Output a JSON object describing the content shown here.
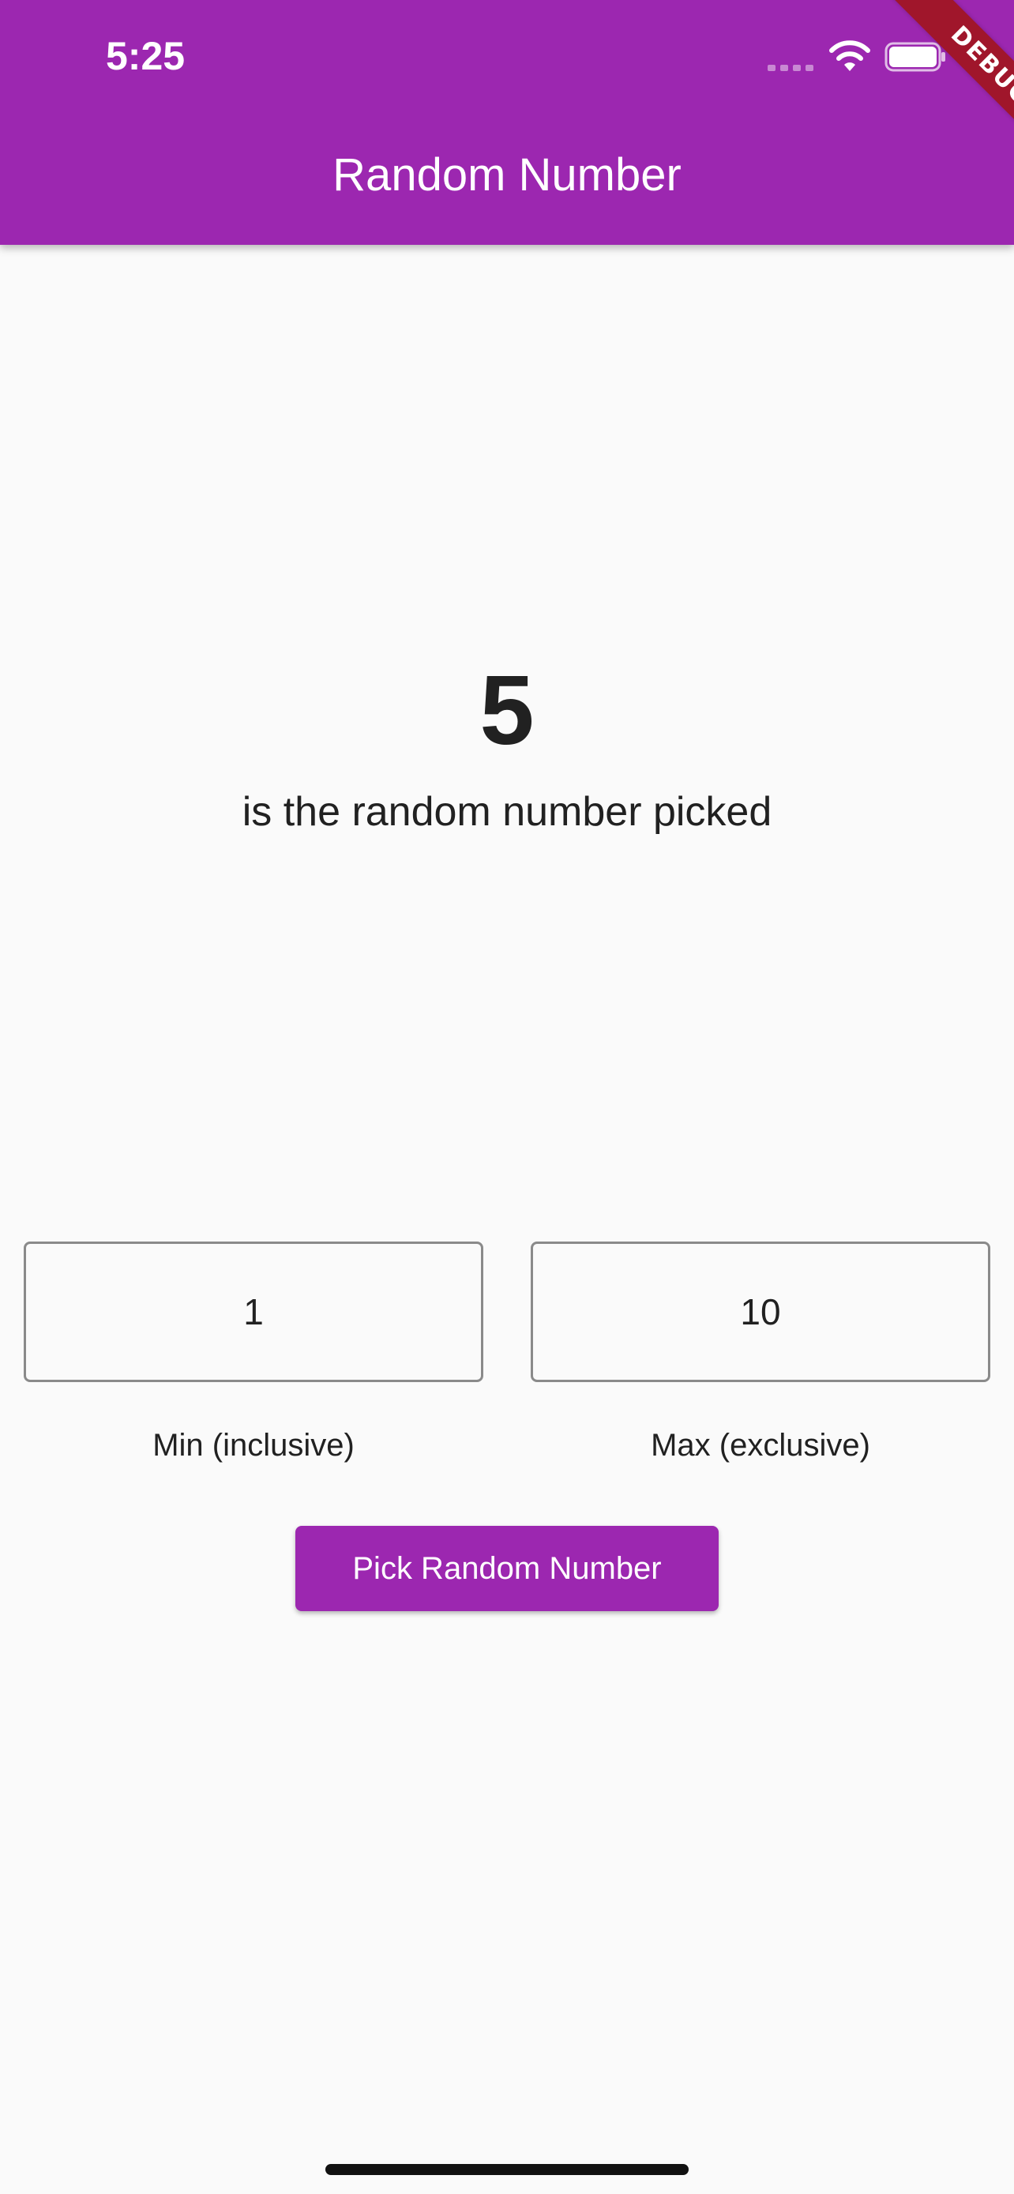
{
  "status_bar": {
    "time": "5:25",
    "icons": [
      "cellular-signal-icon",
      "wifi-icon",
      "battery-icon"
    ]
  },
  "app_bar": {
    "title": "Random Number",
    "debug_banner": "DEBUG"
  },
  "result": {
    "number": "5",
    "caption": "is the random number picked"
  },
  "inputs": {
    "min": {
      "value": "1",
      "label": "Min (inclusive)"
    },
    "max": {
      "value": "10",
      "label": "Max (exclusive)"
    }
  },
  "actions": {
    "pick_label": "Pick Random Number"
  },
  "colors": {
    "primary": "#9c27b0",
    "background": "#fafafa",
    "debug_ribbon": "#a0162b",
    "text": "#212121"
  }
}
